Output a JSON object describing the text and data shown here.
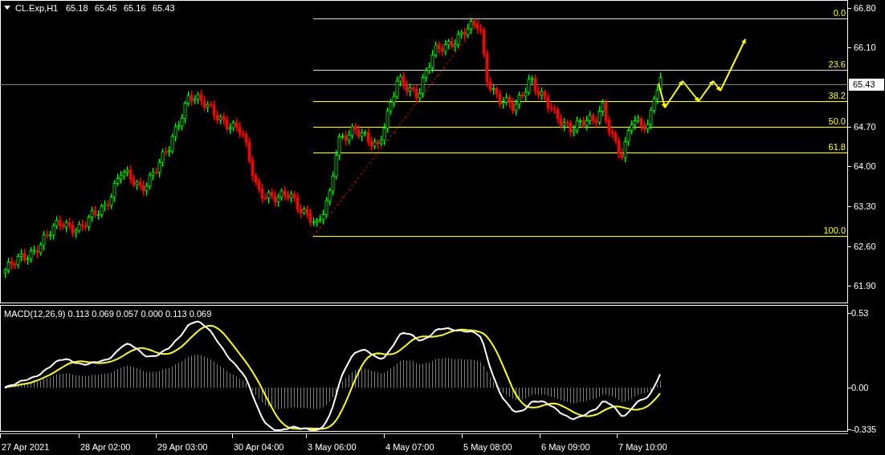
{
  "chart": {
    "symbol": "CL.Exp,H1",
    "ohlc": [
      "65.18",
      "65.45",
      "65.16",
      "65.43"
    ],
    "price_axis": [
      "66.80",
      "66.10",
      "64.70",
      "64.00",
      "63.30",
      "62.60",
      "61.90"
    ],
    "current_price": "65.43",
    "fibonacci_levels": [
      {
        "label": "0.0"
      },
      {
        "label": "23.6"
      },
      {
        "label": "38.2"
      },
      {
        "label": "50.0"
      },
      {
        "label": "61.8"
      },
      {
        "label": "100.0"
      }
    ]
  },
  "macd": {
    "title": "MACD(12,26,9) 0.113 0.069 0.057 0.000 0.113 0.069",
    "axis": [
      "0.53",
      "0.00",
      "-0.335"
    ]
  },
  "time_axis": [
    "27 Apr 2021",
    "28 Apr 02:00",
    "29 Apr 03:00",
    "30 Apr 04:00",
    "3 May 06:00",
    "4 May 07:00",
    "5 May 08:00",
    "6 May 09:00",
    "7 May 10:00"
  ]
}
